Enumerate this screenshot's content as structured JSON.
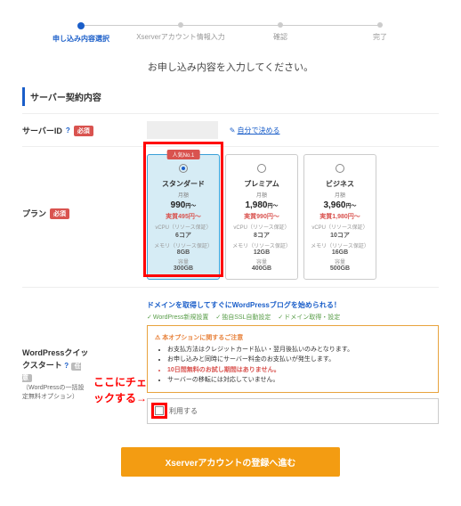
{
  "steps": [
    "申し込み内容選択",
    "Xserverアカウント情報入力",
    "確認",
    "完了"
  ],
  "lead": "お申し込み内容を入力してください。",
  "section_title": "サーバー契約内容",
  "server_id": {
    "label": "サーバーID",
    "help": "?",
    "req": "必須",
    "link": "自分で決める"
  },
  "plan_label": "プラン",
  "req": "必須",
  "plans": [
    {
      "ribbon": "人気No.1",
      "name": "スタンダード",
      "sub": "月額",
      "price": "990",
      "unit": "円～",
      "sale": "実質495円～",
      "cpu_l": "vCPU（リソース保証）",
      "cpu": "6コア",
      "mem_l": "メモリ（リソース保証）",
      "mem": "8GB",
      "disk_l": "容量",
      "disk": "300GB",
      "selected": true
    },
    {
      "name": "プレミアム",
      "sub": "月額",
      "price": "1,980",
      "unit": "円～",
      "sale": "実質990円～",
      "cpu_l": "vCPU（リソース保証）",
      "cpu": "8コア",
      "mem_l": "メモリ（リソース保証）",
      "mem": "12GB",
      "disk_l": "容量",
      "disk": "400GB"
    },
    {
      "name": "ビジネス",
      "sub": "月額",
      "price": "3,960",
      "unit": "円～",
      "sale": "実質1,980円～",
      "cpu_l": "vCPU（リソース保証）",
      "cpu": "10コア",
      "mem_l": "メモリ（リソース保証）",
      "mem": "16GB",
      "disk_l": "容量",
      "disk": "500GB"
    }
  ],
  "promo": "ドメインを取得してすぐにWordPressブログを始められる！",
  "features": [
    "WordPress新規設置",
    "独自SSL自動設定",
    "ドメイン取得・設定"
  ],
  "wp": {
    "label": "WordPressクイックスタート",
    "help": "?",
    "tag": "任意",
    "sub": "（WordPressの一括設定無料オプション）"
  },
  "notice": {
    "title": "本オプションに関するご注意",
    "items": [
      "お支払方法はクレジットカード払い・翌月後払いのみとなります。",
      "お申し込みと同時にサーバー料金のお支払いが発生します。",
      {
        "warn": true,
        "text": "10日間無料のお試し期間はありません。"
      },
      "サーバーの移転には対応していません。"
    ]
  },
  "checkbox_label": "利用する",
  "annotation": "ここにチェックする→",
  "button": "Xserverアカウントの登録へ進む"
}
